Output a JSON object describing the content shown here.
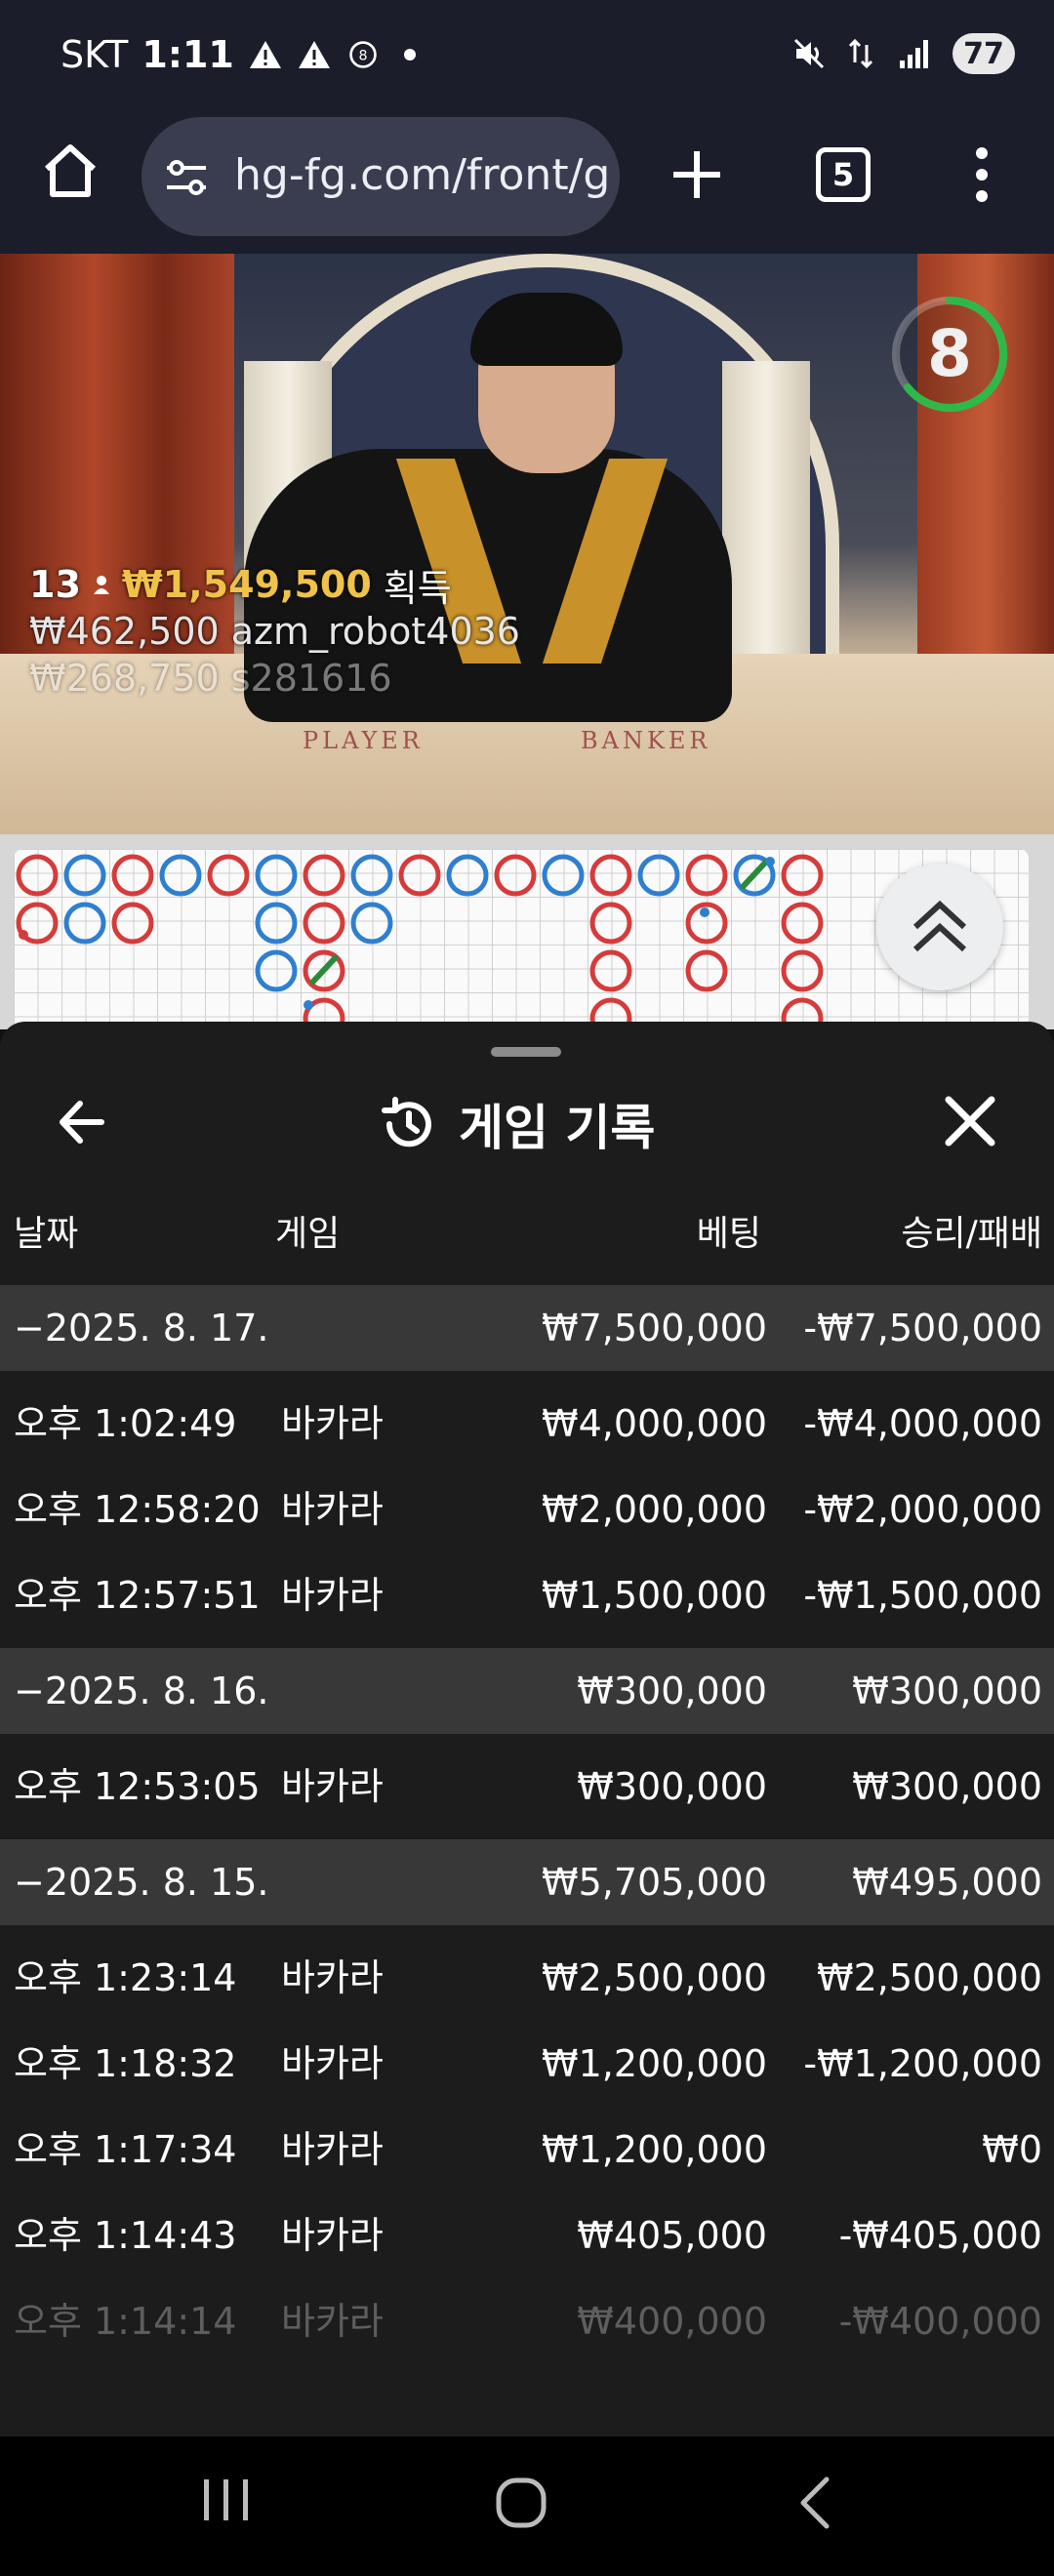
{
  "status_bar": {
    "carrier": "SKT",
    "time": "1:11",
    "battery": "77"
  },
  "browser": {
    "url": "hg-fg.com/front/g",
    "tab_count": "5"
  },
  "video": {
    "timer": "8",
    "winners": [
      {
        "count": "13",
        "amount": "₩1,549,500",
        "suffix": "획득"
      },
      {
        "amount": "₩462,500",
        "user": "azm_robot4036"
      },
      {
        "amount": "₩268,750",
        "user": "s281616"
      }
    ],
    "table_text": {
      "left": "PLAYER",
      "right": "BANKER"
    }
  },
  "sheet": {
    "title": "게임 기록",
    "columns": {
      "date": "날짜",
      "game": "게임",
      "bet": "베팅",
      "result": "승리/패배"
    },
    "rows": [
      {
        "type": "group",
        "date": "−2025. 8. 17.",
        "game": "",
        "bet": "₩7,500,000",
        "result": "-₩7,500,000"
      },
      {
        "type": "item",
        "date": "오후 1:02:49",
        "game": "바카라",
        "bet": "₩4,000,000",
        "result": "-₩4,000,000"
      },
      {
        "type": "item",
        "date": "오후 12:58:20",
        "game": "바카라",
        "bet": "₩2,000,000",
        "result": "-₩2,000,000"
      },
      {
        "type": "item",
        "date": "오후 12:57:51",
        "game": "바카라",
        "bet": "₩1,500,000",
        "result": "-₩1,500,000"
      },
      {
        "type": "group",
        "date": "−2025. 8. 16.",
        "game": "",
        "bet": "₩300,000",
        "result": "₩300,000"
      },
      {
        "type": "item",
        "date": "오후 12:53:05",
        "game": "바카라",
        "bet": "₩300,000",
        "result": "₩300,000"
      },
      {
        "type": "group",
        "date": "−2025. 8. 15.",
        "game": "",
        "bet": "₩5,705,000",
        "result": "₩495,000"
      },
      {
        "type": "item",
        "date": "오후 1:23:14",
        "game": "바카라",
        "bet": "₩2,500,000",
        "result": "₩2,500,000"
      },
      {
        "type": "item",
        "date": "오후 1:18:32",
        "game": "바카라",
        "bet": "₩1,200,000",
        "result": "-₩1,200,000"
      },
      {
        "type": "item",
        "date": "오후 1:17:34",
        "game": "바카라",
        "bet": "₩1,200,000",
        "result": "₩0"
      },
      {
        "type": "item",
        "date": "오후 1:14:43",
        "game": "바카라",
        "bet": "₩405,000",
        "result": "-₩405,000"
      },
      {
        "type": "item",
        "date": "오후 1:14:14",
        "game": "바카라",
        "bet": "₩400,000",
        "result": "-₩400,000"
      }
    ]
  },
  "colors": {
    "banker_red": "#d63b3b",
    "player_blue": "#2f7fd1",
    "tie_green": "#2a8a3a",
    "timer_green": "#2fb84a",
    "winner_gold": "#f0c24a"
  },
  "icons": {
    "home": "home-icon",
    "tune": "tune-icon",
    "new_tab": "plus-icon",
    "menu": "more-vertical-icon",
    "back": "arrow-left-icon",
    "history": "history-icon",
    "close": "close-icon",
    "scroll_up": "double-chevron-up-icon"
  }
}
